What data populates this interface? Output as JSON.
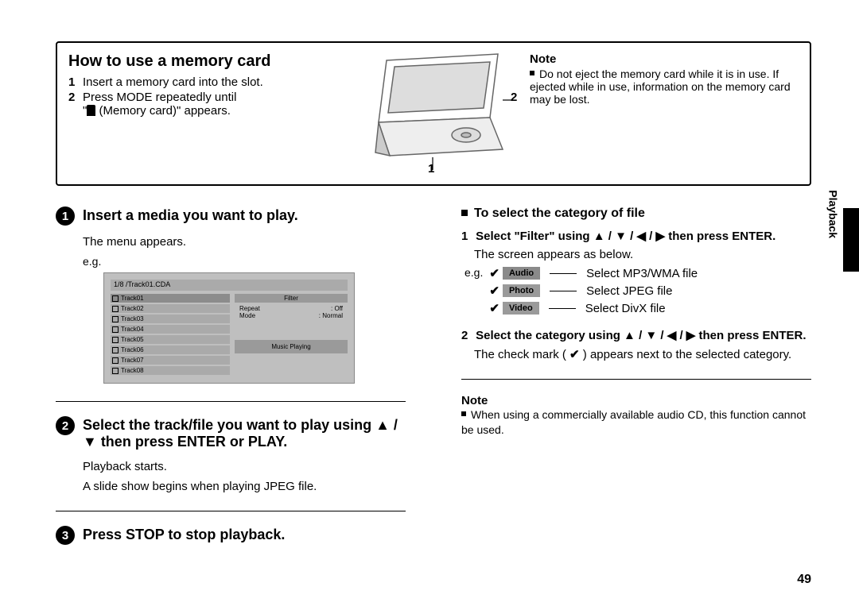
{
  "top": {
    "title": "How to use a memory card",
    "steps": [
      "Insert a memory card into the slot.",
      "Press MODE repeatedly until \" (Memory card)\" appears."
    ],
    "callouts": {
      "one": "1",
      "two": "2"
    },
    "note_label": "Note",
    "note_text": "Do not eject the memory card while it is in use. If ejected while in use, information on the memory card may be lost."
  },
  "left": {
    "step1_title": "Insert a media you want to play.",
    "menu_appears": "The menu appears.",
    "eg": "e.g.",
    "screen": {
      "top": "1/8     /Track01.CDA",
      "tracks": [
        "Track01",
        "Track02",
        "Track03",
        "Track04",
        "Track05",
        "Track06",
        "Track07",
        "Track08"
      ],
      "filter": "Filter",
      "repeat_k": "Repeat",
      "repeat_v": ": Off",
      "mode_k": "Mode",
      "mode_v": ": Normal",
      "status": "Music Playing"
    },
    "step2_title": "Select the track/file you want to play using ▲ / ▼ then press ENTER or PLAY.",
    "playback_starts": "Playback starts.",
    "slide_show": "A slide show begins when playing JPEG file.",
    "step3_title": "Press STOP to stop playback."
  },
  "right": {
    "heading": "To select the category of file",
    "s1": "Select \"Filter\" using ▲ / ▼ / ◀ / ▶ then press ENTER.",
    "s1_text": "The screen appears as below.",
    "eg": "e.g.",
    "filters": [
      {
        "label": "Audio",
        "desc": "Select MP3/WMA file"
      },
      {
        "label": "Photo",
        "desc": "Select JPEG file"
      },
      {
        "label": "Video",
        "desc": "Select DivX file"
      }
    ],
    "s2": "Select the category using ▲ / ▼ / ◀ / ▶ then press ENTER.",
    "s2_text_a": "The check mark (",
    "s2_text_b": ") appears next to the selected category.",
    "note_label": "Note",
    "note_text": "When using a commercially available audio CD, this function cannot be used."
  },
  "page_number": "49",
  "side_label": "Playback"
}
